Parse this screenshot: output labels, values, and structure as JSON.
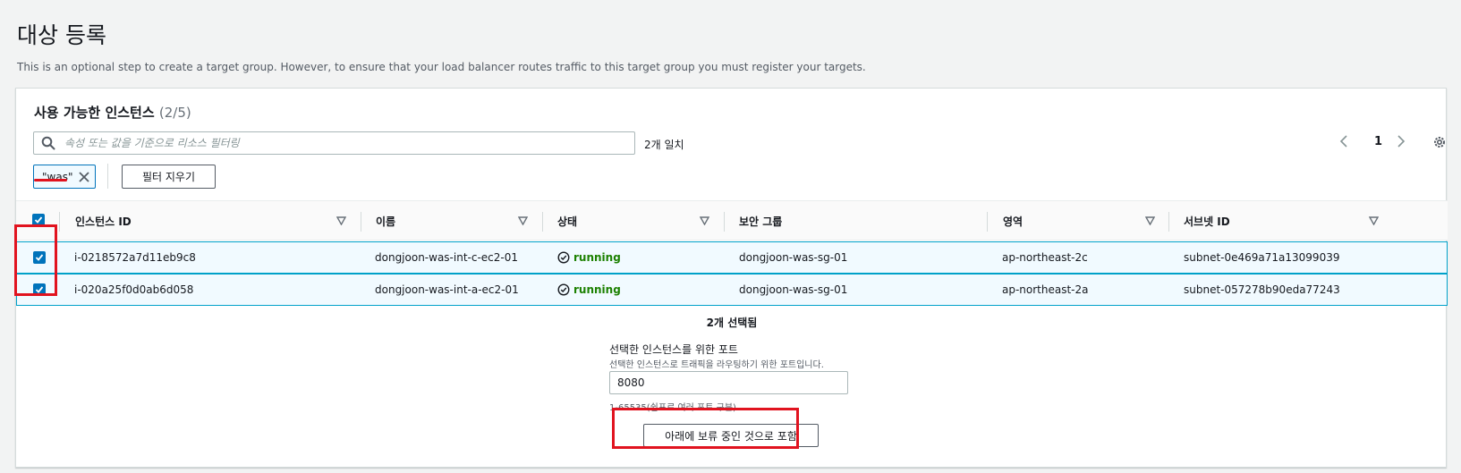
{
  "page": {
    "title": "대상 등록",
    "description": "This is an optional step to create a target group. However, to ensure that your load balancer routes traffic to this target group you must register your targets."
  },
  "panel": {
    "title": "사용 가능한 인스턴스",
    "count": "(2/5)"
  },
  "search": {
    "placeholder": "속성 또는 값을 기준으로 리소스 필터링",
    "value": "",
    "match_count": "2개 일치"
  },
  "pagination": {
    "current_page": "1"
  },
  "filter": {
    "token_label": "\"was\"",
    "clear_label": "필터 지우기"
  },
  "table": {
    "columns": [
      "인스턴스 ID",
      "이름",
      "상태",
      "보안 그룹",
      "영역",
      "서브넷 ID"
    ],
    "rows": [
      {
        "checked": true,
        "instance_id": "i-0218572a7d11eb9c8",
        "name": "dongjoon-was-int-c-ec2-01",
        "state": "running",
        "security_group": "dongjoon-was-sg-01",
        "zone": "ap-northeast-2c",
        "subnet_id": "subnet-0e469a71a13099039"
      },
      {
        "checked": true,
        "instance_id": "i-020a25f0d0ab6d058",
        "name": "dongjoon-was-int-a-ec2-01",
        "state": "running",
        "security_group": "dongjoon-was-sg-01",
        "zone": "ap-northeast-2a",
        "subnet_id": "subnet-057278b90eda77243"
      }
    ]
  },
  "selection": {
    "selected_text": "2개 선택됨",
    "port_label": "선택한 인스턴스를 위한 포트",
    "port_description": "선택한 인스턴스로 트래픽을 라우팅하기 위한 포트입니다.",
    "port_value": "8080",
    "port_hint": "1-65535(쉼표로 여러 포트 구분)",
    "include_button": "아래에 보류 중인 것으로 포함"
  },
  "colors": {
    "accent": "#0073bb",
    "running": "#1d8102",
    "highlight": "#e1131f",
    "row_selected_bg": "#f1faff"
  }
}
